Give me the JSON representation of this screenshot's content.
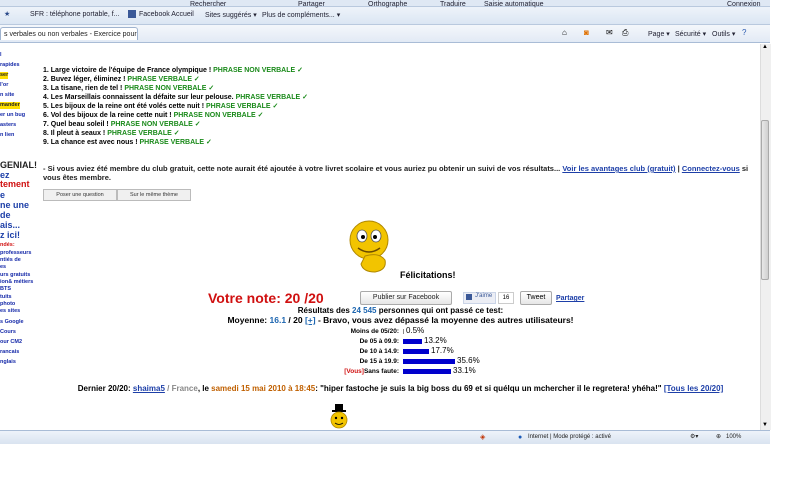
{
  "browser": {
    "search_label": "Rechercher",
    "share_label": "Partager",
    "orthographe_label": "Orthographe",
    "traduire_label": "Traduire",
    "autofill_label": "Saisie automatique",
    "connexion_label": "Connexion",
    "favorites": [
      "SFR : téléphone portable, f...",
      "Facebook Accueil",
      "Sites suggérés ▾",
      "Plus de compléments... ▾"
    ],
    "tab_title": "s verbales ou non verbales - Exercice pour ...",
    "tools": [
      "Page ▾",
      "Sécurité ▾",
      "Outils ▾"
    ]
  },
  "sidebar": {
    "items": [
      "l",
      "rapides",
      "ser",
      "l'or",
      "n site",
      "mander",
      "er un bug",
      "asters",
      "n lien",
      "GENIAL!",
      "ez",
      "tement",
      "e",
      "ne une",
      "de",
      "ais...",
      "z ici!",
      "ndés:",
      "professeurs",
      "ntiés de",
      "es",
      "urs gratuits",
      "ion& métiers",
      "BTS",
      "tuits",
      "photo",
      "es sites",
      "s Google",
      "Cours",
      "our CM2",
      "rancais",
      "nglais"
    ]
  },
  "exercise": {
    "answers": [
      {
        "text": "1. Large victoire de l'équipe de France olympique ! ",
        "result": "PHRASE NON VERBALE ✓"
      },
      {
        "text": "2. Buvez léger, éliminez ! ",
        "result": "PHRASE VERBALE ✓"
      },
      {
        "text": "3. La tisane, rien de tel ! ",
        "result": "PHRASE NON VERBALE ✓"
      },
      {
        "text": "4. Les Marseillais connaissent la défaite sur leur pelouse. ",
        "result": "PHRASE VERBALE ✓"
      },
      {
        "text": "5. Les bijoux de la reine ont été volés cette nuit ! ",
        "result": "PHRASE VERBALE ✓"
      },
      {
        "text": "6. Vol des bijoux de la reine cette nuit ! ",
        "result": "PHRASE NON VERBALE ✓"
      },
      {
        "text": "7. Quel beau soleil ! ",
        "result": "PHRASE NON VERBALE ✓"
      },
      {
        "text": "8. Il pleut à seaux ! ",
        "result": "PHRASE VERBALE ✓"
      },
      {
        "text": "9. La chance est avec nous ! ",
        "result": "PHRASE VERBALE ✓"
      }
    ],
    "promo_text": "- Si vous aviez été membre du club gratuit, cette note aurait été ajoutée à votre livret scolaire et vous auriez pu obtenir un suivi de vos résultats...",
    "promo_link1": "Voir les avantages club (gratuit)",
    "promo_sep": " | ",
    "promo_link2": "Connectez-vous",
    "promo_tail": " si vous êtes membre.",
    "btn_question": "Poser une question",
    "btn_theme": "Sur le même thème",
    "felicitations": "Félicitations!",
    "note_label": "Votre note: 20 /20",
    "fb_share": "Publier sur Facebook",
    "fb_like": "J'aime",
    "fb_count": "16",
    "tweet": "Tweet",
    "partager": "Partager",
    "results_prefix": "Résultats des ",
    "results_count": "24 545",
    "results_suffix": " personnes qui ont passé ce test:",
    "avg_prefix": "Moyenne: ",
    "avg_value": "16.1",
    "avg_mid": " / 20 ",
    "avg_plus": "[+]",
    "avg_suffix": " - Bravo, vous avez dépassé la moyenne des autres utilisateurs!",
    "stats": [
      {
        "label": "Moins de 05/20:",
        "pct": "0.5%",
        "value": 0.5
      },
      {
        "label": "De 05 à 09.9:",
        "pct": "13.2%",
        "value": 13.2
      },
      {
        "label": "De 10 à 14.9:",
        "pct": "17.7%",
        "value": 17.7
      },
      {
        "label": "De 15 à 19.9:",
        "pct": "35.6%",
        "value": 35.6
      },
      {
        "label": "Sans faute:",
        "pct": "33.1%",
        "value": 33.1
      }
    ],
    "vous_tag": "[Vous]",
    "last_prefix": "Dernier 20/20: ",
    "last_user": "shaima5",
    "last_country": " / France",
    "last_mid": ", le ",
    "last_date": "samedi 15 mai 2010 à 18:45",
    "last_quote": ": \"hiper fastoche je suis la big boss du 69 et si quélqu un mchercher il le regretera! yhéha!\" ",
    "last_link": "[Tous les 20/20]"
  },
  "statusbar": {
    "zone": "Internet | Mode protégé : activé",
    "zoom": "100%"
  },
  "colors": {
    "accent_green": "#1a8a1a",
    "note_red": "#d01010",
    "link_blue": "#1d3fa8",
    "bar_blue": "#0000cc"
  }
}
